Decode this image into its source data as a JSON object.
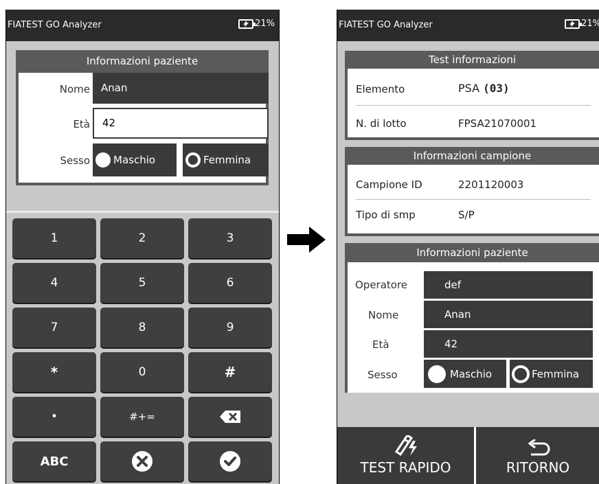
{
  "left": {
    "status": {
      "title": "FIATEST GO Analyzer",
      "battery": "21%"
    },
    "patient": {
      "header": "Informazioni paziente",
      "name_label": "Nome",
      "name_value": "Anan",
      "age_label": "Età",
      "age_value": "42",
      "sex_label": "Sesso",
      "male": "Maschio",
      "female": "Femmina"
    },
    "keypad": {
      "k1": "1",
      "k2": "2",
      "k3": "3",
      "k4": "4",
      "k5": "5",
      "k6": "6",
      "k7": "7",
      "k8": "8",
      "k9": "9",
      "kstar": "*",
      "k0": "0",
      "khash": "#",
      "kdot": "•",
      "ksym": "#+=",
      "kabc": "ABC"
    }
  },
  "right": {
    "status": {
      "title": "FIATEST GO Analyzer",
      "battery": "21%"
    },
    "test_info": {
      "header": "Test informazioni",
      "element_label": "Elemento",
      "element_value": "PSA",
      "element_code": "(03)",
      "lot_label": "N. di lotto",
      "lot_value": "FPSA21070001"
    },
    "sample_info": {
      "header": "Informazioni campione",
      "id_label": "Campione ID",
      "id_value": "2201120003",
      "type_label": "Tipo di smp",
      "type_value": "S/P"
    },
    "patient_info": {
      "header": "Informazioni paziente",
      "operator_label": "Operatore",
      "operator_value": "def",
      "name_label": "Nome",
      "name_value": "Anan",
      "age_label": "Età",
      "age_value": "42",
      "sex_label": "Sesso",
      "male": "Maschio",
      "female": "Femmina"
    },
    "buttons": {
      "quick_test": "TEST RAPIDO",
      "back": "RITORNO"
    }
  }
}
